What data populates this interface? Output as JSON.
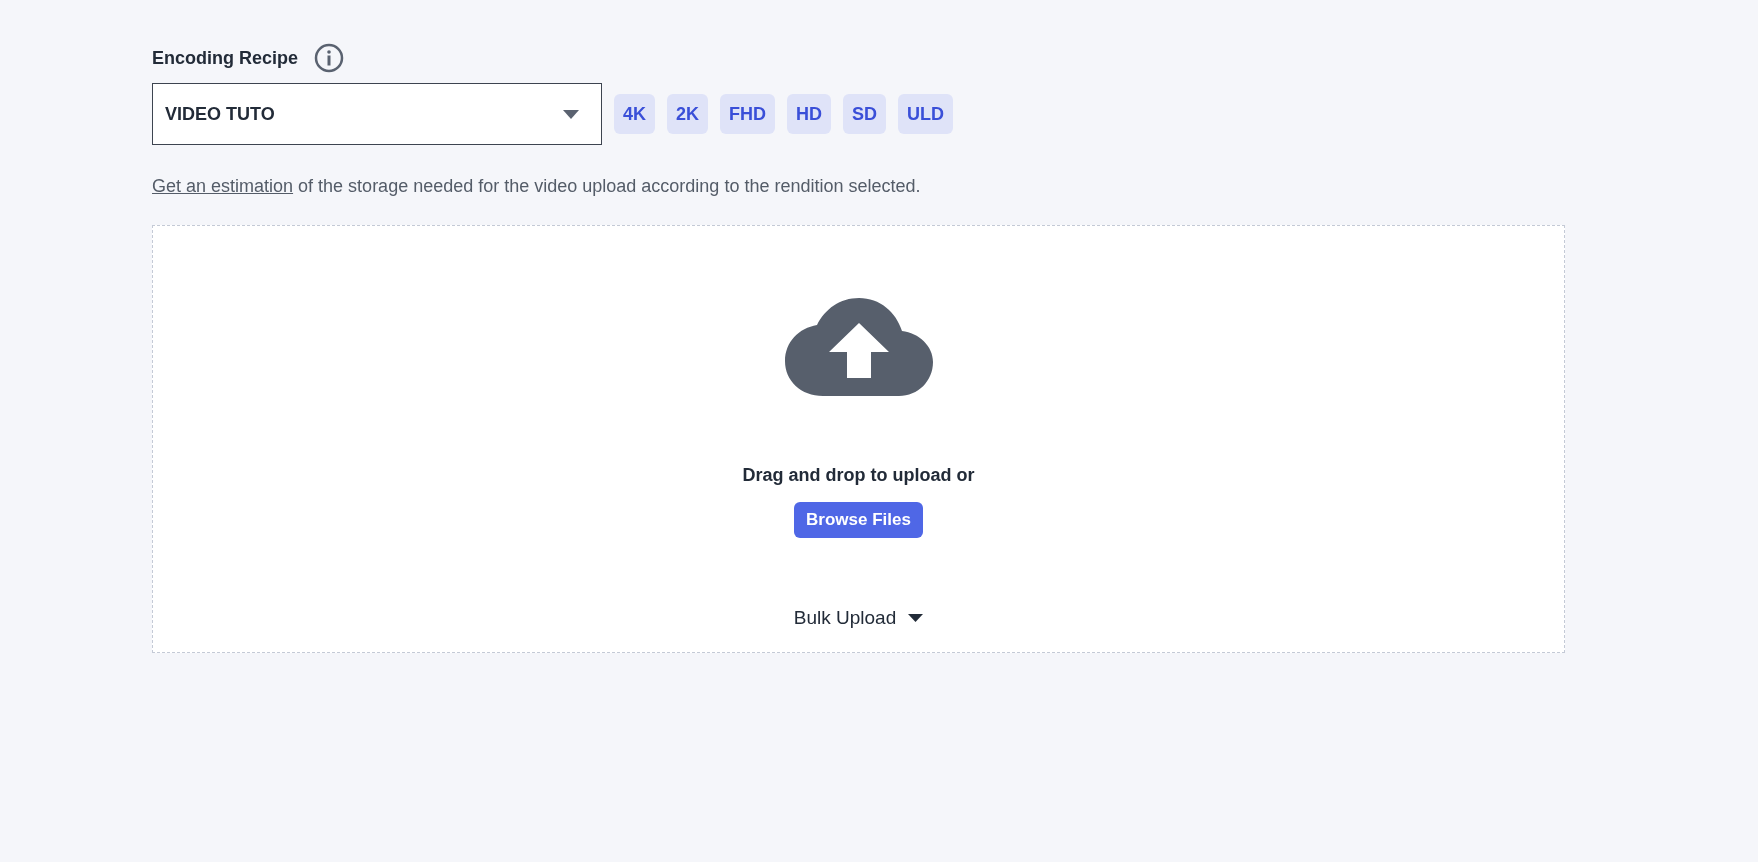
{
  "recipe": {
    "label": "Encoding Recipe",
    "value": "VIDEO TUTO",
    "renditions": [
      "4K",
      "2K",
      "FHD",
      "HD",
      "SD",
      "ULD"
    ]
  },
  "estimation": {
    "link": "Get an estimation",
    "text": " of the storage needed for the video upload according to the rendition selected."
  },
  "dropzone": {
    "prompt": "Drag and drop to upload or",
    "button": "Browse Files",
    "bulk": "Bulk Upload"
  }
}
